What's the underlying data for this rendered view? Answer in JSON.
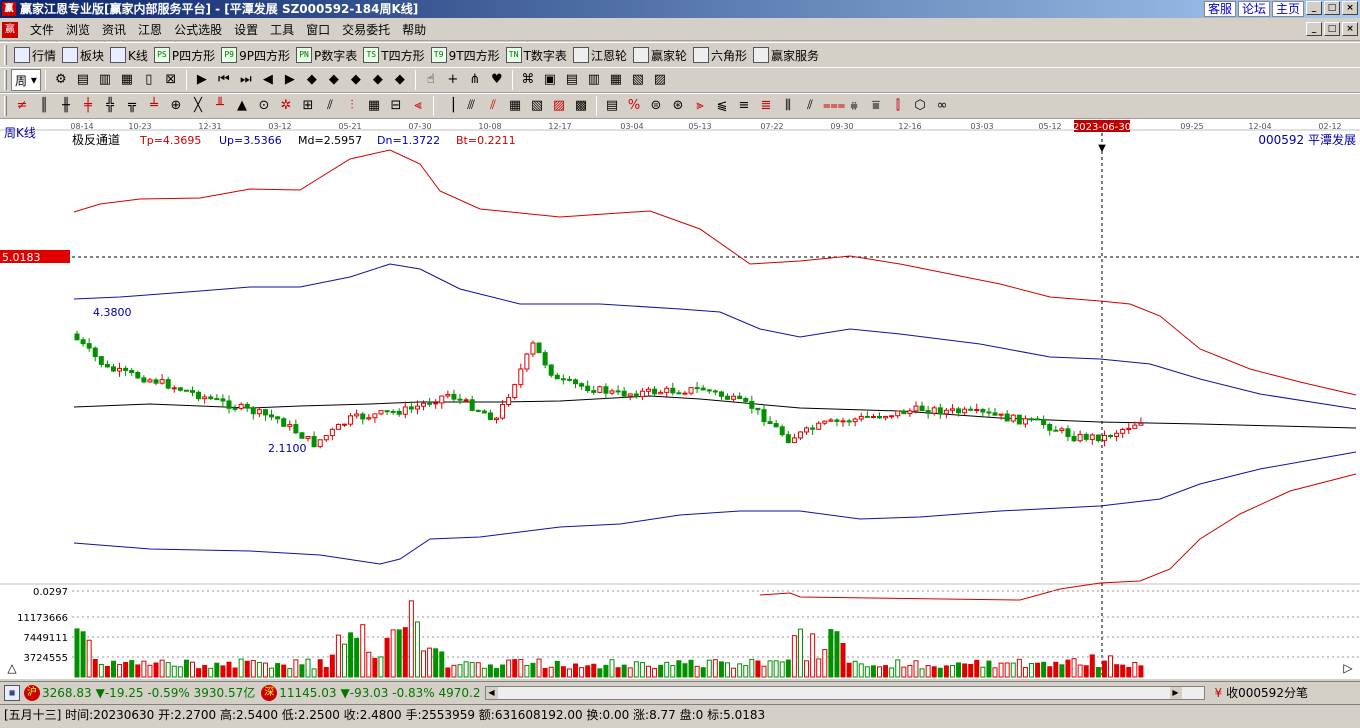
{
  "window": {
    "title": "赢家江恩专业版[赢家内部服务平台] - [平潭发展  SZ000592-184周K线]",
    "app_icon": "赢",
    "links": [
      "客服",
      "论坛",
      "主页"
    ],
    "win_buttons": [
      "_",
      "□",
      "×"
    ]
  },
  "menu": {
    "icon": "赢",
    "items": [
      "文件",
      "浏览",
      "资讯",
      "江恩",
      "公式选股",
      "设置",
      "工具",
      "窗口",
      "交易委托",
      "帮助"
    ]
  },
  "toolbar1": [
    {
      "icon": "grid-icon",
      "label": "行情"
    },
    {
      "icon": "blocks-icon",
      "label": "板块"
    },
    {
      "icon": "kline-icon",
      "label": "K线"
    },
    {
      "icon": "PS",
      "label": "P四方形"
    },
    {
      "icon": "P9",
      "label": "9P四方形"
    },
    {
      "icon": "PN",
      "label": "P数字表"
    },
    {
      "icon": "TS",
      "label": "T四方形"
    },
    {
      "icon": "T9",
      "label": "9T四方形"
    },
    {
      "icon": "TN",
      "label": "T数字表"
    },
    {
      "icon": "wheel-icon",
      "label": "江恩轮"
    },
    {
      "icon": "wheel2-icon",
      "label": "赢家轮"
    },
    {
      "icon": "hexagon-icon",
      "label": "六角形"
    },
    {
      "icon": "dollar-icon",
      "label": "赢家服务"
    }
  ],
  "toolbar2": {
    "period": "周",
    "glyphs": [
      "⚙",
      "▤",
      "▥",
      "▦",
      "▯",
      "⊠",
      "▶",
      "⏮",
      "⏭",
      "◀",
      "▶",
      "◆",
      "◆",
      "◆",
      "◆",
      "◆",
      "☝",
      "+",
      "⋔",
      "♥",
      "⌘",
      "▣",
      "▤",
      "▥",
      "▦",
      "▧",
      "▨"
    ]
  },
  "toolbar3": {
    "glyphs": [
      "≠",
      "║",
      "╫",
      "╪",
      "╬",
      "╦",
      "╧",
      "⊕",
      "╳",
      "╨",
      "▲",
      "⊙",
      "✲",
      "⊞",
      "⫽",
      "⫶",
      "▦",
      "⊟",
      "⫷",
      "▕",
      "⫻",
      "⫽",
      "▦",
      "▧",
      "▨",
      "▩",
      "▤",
      "%",
      "⊜",
      "⊛",
      "⫸",
      "⫹",
      "≡",
      "≣",
      "⫼",
      "⫽",
      "⩶",
      "⩷",
      "⩸",
      "⫿",
      "⬡",
      "∞"
    ]
  },
  "chart": {
    "period_label": "周K线",
    "indicator": {
      "name": "极反通道",
      "tp": "Tp=4.3695",
      "up": "Up=3.5366",
      "md": "Md=2.5957",
      "dn": "Dn=1.3722",
      "bt": "Bt=0.2211"
    },
    "stock_label": "000592  平潭发展",
    "date_ticks": [
      "08-14",
      "10-23",
      "12-31",
      "03-12",
      "05-21",
      "07-30",
      "10-08",
      "12-17",
      "03-04",
      "05-13",
      "07-22",
      "09-30",
      "12-16",
      "03-03",
      "05-12",
      "2023-06-30",
      "09-25",
      "12-04",
      "02-12"
    ],
    "price_marker": "5.0183",
    "high_label": "4.3800",
    "low_label": "2.1100",
    "vol_axis": [
      "0.0297",
      "11173666",
      "7449111",
      "3724555"
    ],
    "colors": {
      "up": "#e00000",
      "down": "#009000",
      "band_outer": "#d00000",
      "band_inner": "#1010a0",
      "mid": "#000000"
    }
  },
  "chart_data": {
    "type": "candlestick",
    "title": "",
    "period": "weekly",
    "xlabel": "",
    "ylabel": "",
    "crosshair_date": "2023-06-30",
    "price_marker": 5.0183,
    "max_label": 4.38,
    "min_label": 2.11,
    "channel": {
      "Tp": 4.3695,
      "Up": 3.5366,
      "Md": 2.5957,
      "Dn": 1.3722,
      "Bt": 0.2211
    },
    "volume_ticks": [
      0.0297,
      3724555,
      7449111,
      11173666
    ]
  },
  "status": {
    "sh_badge": "沪",
    "sh": "3268.83",
    "sh_chg": "▼-19.25 -0.59% 3930.57亿",
    "sz_badge": "深",
    "sz": "11145.03",
    "sz_chg": "▼-93.03 -0.83% 4970.2",
    "ticker": "收000592分笔"
  },
  "info": "[五月十三] 时间:20230630 开:2.2700 高:2.5400 低:2.2500 收:2.4800 手:2553959 额:631608192.00 换:0.00 涨:8.77 盘:0 标:5.0183"
}
